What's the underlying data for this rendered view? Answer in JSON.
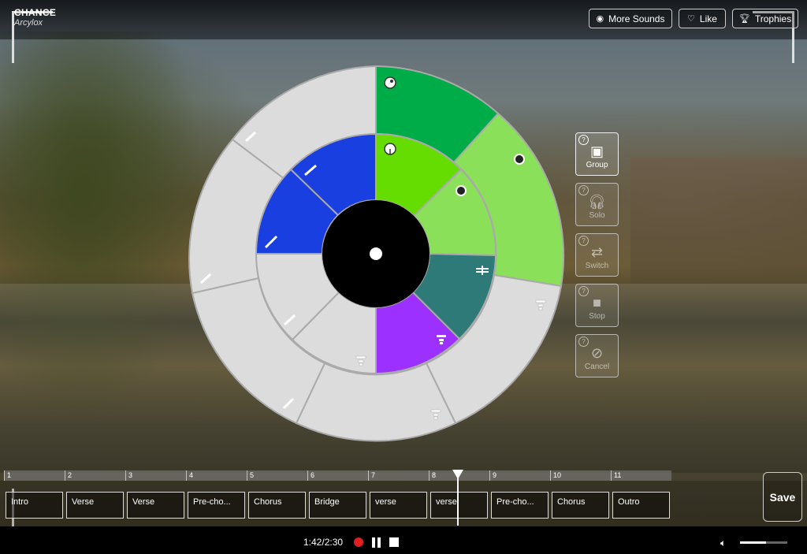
{
  "app": {
    "title": "CHANCE",
    "artist": "Arcylox"
  },
  "top_buttons": {
    "more_sounds": "More Sounds",
    "like": "Like",
    "trophies": "Trophies"
  },
  "side_tools": [
    {
      "label": "Group",
      "icon": "group-icon",
      "active": true
    },
    {
      "label": "Solo",
      "icon": "headphones-icon",
      "active": false
    },
    {
      "label": "Switch",
      "icon": "switch-arrows-icon",
      "active": false
    },
    {
      "label": "Stop",
      "icon": "stop-icon",
      "active": false
    },
    {
      "label": "Cancel",
      "icon": "cancel-icon",
      "active": false
    }
  ],
  "timeline": {
    "bars": [
      "1",
      "2",
      "3",
      "4",
      "5",
      "6",
      "7",
      "8",
      "9",
      "10",
      "11"
    ],
    "sections": [
      "Intro",
      "Verse",
      "Verse",
      "Pre-cho...",
      "Chorus",
      "Bridge",
      "verse",
      "verse",
      "Pre-cho...",
      "Chorus",
      "Outro"
    ]
  },
  "playback": {
    "time": "1:42/2:30",
    "volume": 0.55
  },
  "save_label": "Save",
  "colors": {
    "green_dark": "#00ac47",
    "green_light": "#8be05a",
    "lime": "#66dd00",
    "blue": "#1a3fe0",
    "teal": "#2e7a78",
    "purple": "#9b30ff",
    "ring_gray": "#dcdcdc",
    "record": "#e02020"
  }
}
